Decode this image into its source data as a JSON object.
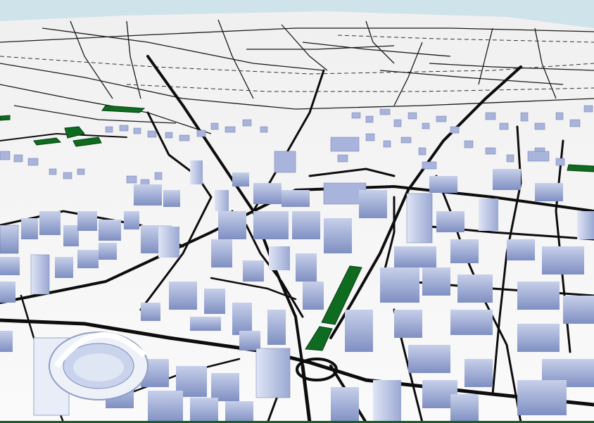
{
  "map": {
    "view": "3d-perspective-city",
    "colors": {
      "sky": "#cfe3ea",
      "ground_far": "#f2f2f1",
      "ground_near": "#f7f7f7",
      "road": "#111111",
      "road_minor": "#2a2a2a",
      "park": "#0f6b1f",
      "building_top": "#e9eef8",
      "building_side": "#8f9dc8",
      "building_shadow": "#6f7fb3",
      "stadium": "#eef2f8"
    },
    "layers": [
      "terrain",
      "roads",
      "parks",
      "buildings"
    ]
  }
}
